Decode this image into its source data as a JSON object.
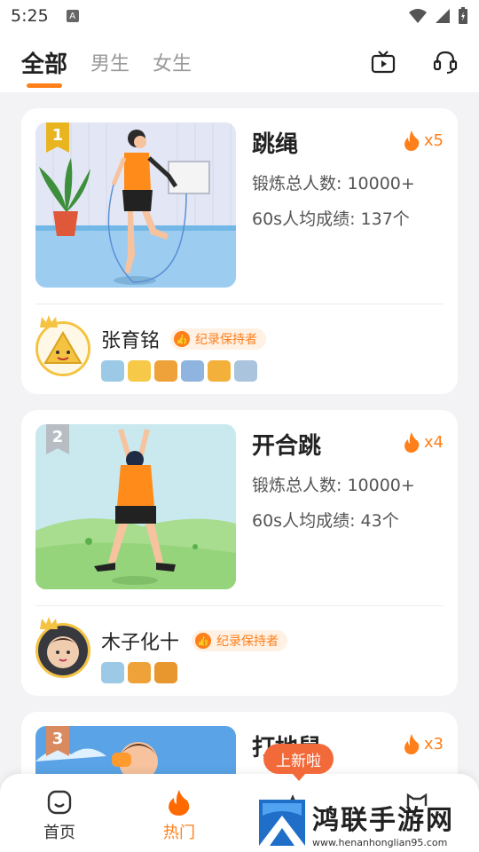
{
  "status": {
    "time": "5:25",
    "a_icon": "A"
  },
  "tabs": [
    {
      "label": "全部",
      "active": true
    },
    {
      "label": "男生",
      "active": false
    },
    {
      "label": "女生",
      "active": false
    }
  ],
  "header_icons": [
    "tv-icon",
    "headset-icon"
  ],
  "accent_color": "#ff7f1a",
  "cards": [
    {
      "rank": "1",
      "title": "跳绳",
      "fire_count": "x5",
      "total": "锻炼总人数: 10000+",
      "score": "60s人均成绩: 137个",
      "holder_name": "张育铭",
      "badge": "纪录保持者",
      "medals": 6
    },
    {
      "rank": "2",
      "title": "开合跳",
      "fire_count": "x4",
      "total": "锻炼总人数: 10000+",
      "score": "60s人均成绩: 43个",
      "holder_name": "木子化十",
      "badge": "纪录保持者",
      "medals": 3
    },
    {
      "rank": "3",
      "title": "打地鼠",
      "fire_count": "x3"
    }
  ],
  "new_tag": "上新啦",
  "nav": [
    {
      "label": "首页",
      "icon": "home-icon",
      "active": false
    },
    {
      "label": "热门",
      "icon": "fire-icon",
      "active": true
    }
  ],
  "watermark": {
    "title": "鸿联手游网",
    "url": "www.henanhonglian95.com"
  }
}
